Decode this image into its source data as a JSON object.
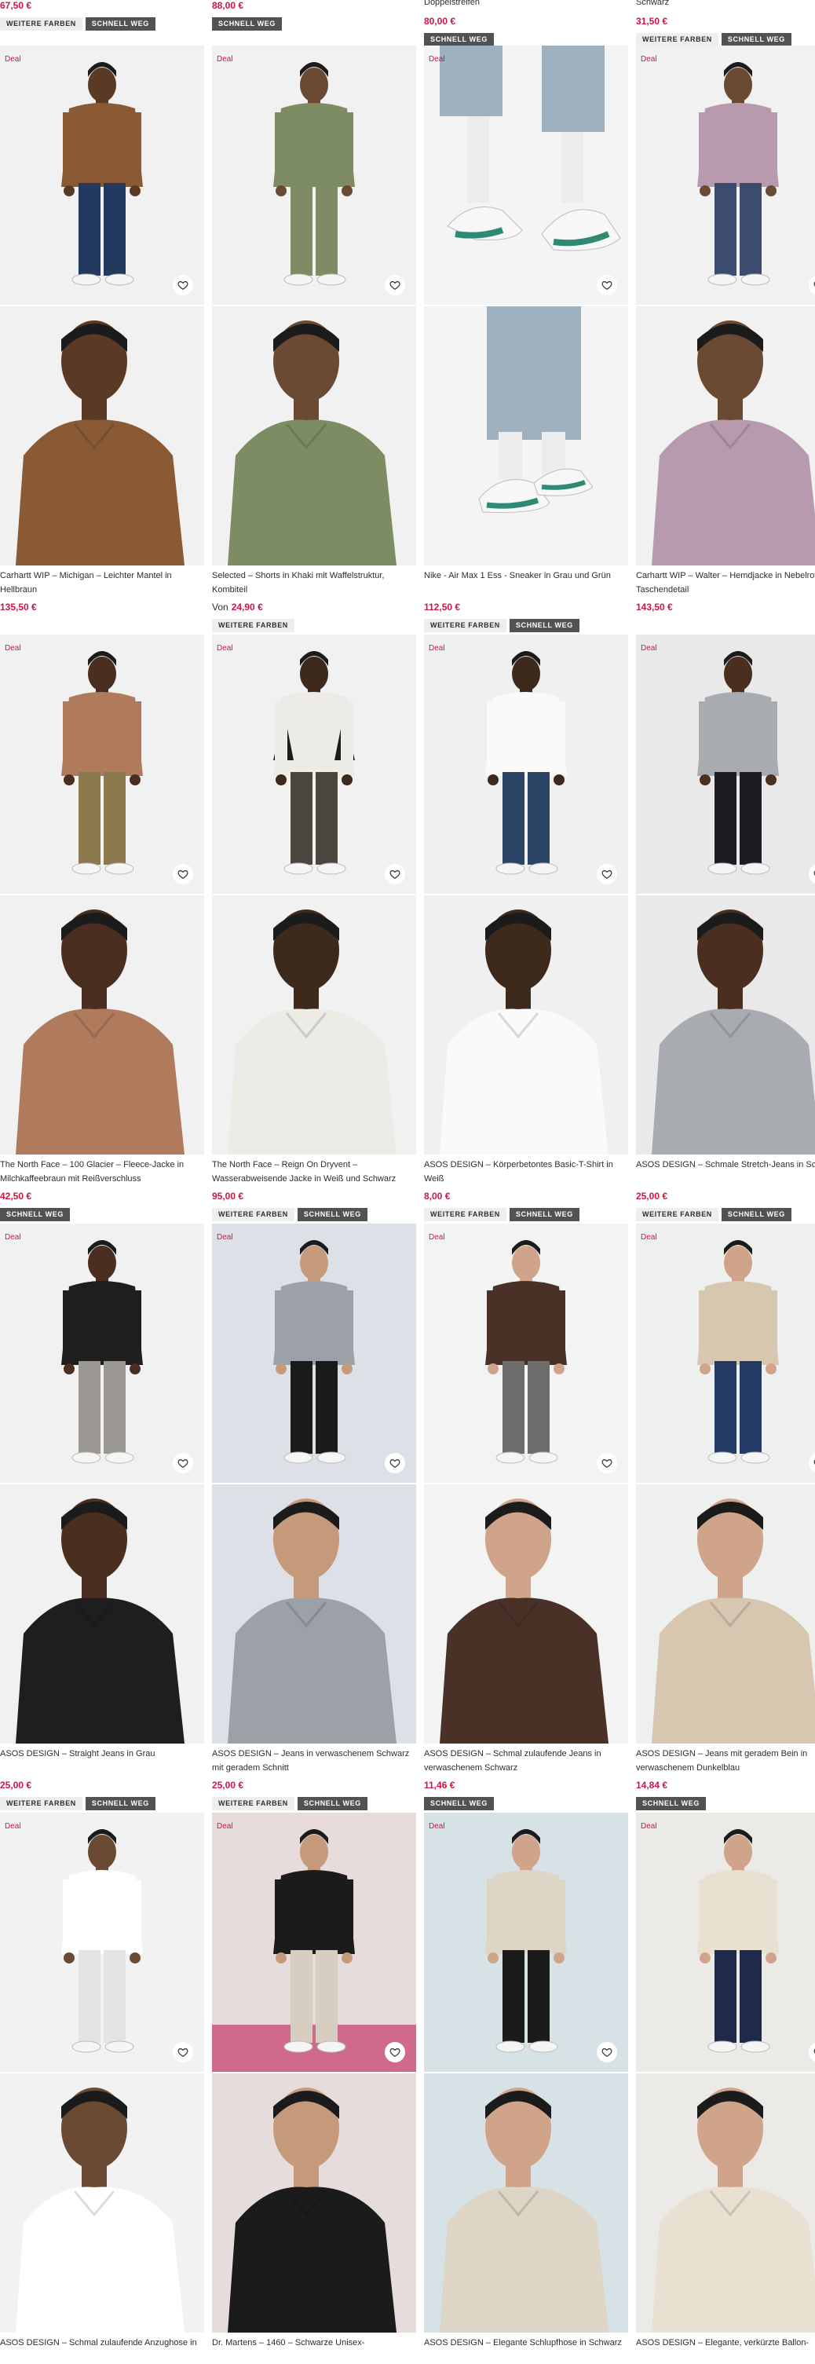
{
  "top": [
    {
      "price": "67,50 €",
      "badges": [
        "WEITERE FARBEN",
        "SCHNELL WEG"
      ]
    },
    {
      "price": "88,00 €",
      "badges": [
        "SCHNELL WEG"
      ]
    },
    {
      "title": "Doppelstreifen",
      "price": "80,00 €",
      "badges": [
        "SCHNELL WEG"
      ]
    },
    {
      "title": "Schwarz",
      "price": "31,50 €",
      "badges": [
        "WEITERE FARBEN",
        "SCHNELL WEG"
      ]
    }
  ],
  "products": [
    {
      "deal": "Deal",
      "title": "Carhartt WIP – Michigan – Leichter Mantel in Hellbraun",
      "from": "",
      "price": "135,50 €",
      "badges": []
    },
    {
      "deal": "Deal",
      "title": "Selected – Shorts in Khaki mit Waffelstruktur, Kombiteil",
      "from": "Von",
      "price": "24,90 €",
      "badges": [
        "WEITERE FARBEN"
      ]
    },
    {
      "deal": "Deal",
      "title": "Nike - Air Max 1 Ess - Sneaker in Grau und Grün",
      "from": "",
      "price": "112,50 €",
      "badges": [
        "WEITERE FARBEN",
        "SCHNELL WEG"
      ]
    },
    {
      "deal": "Deal",
      "title": "Carhartt WIP – Walter – Hemdjacke in Nebelrot mit Taschendetail",
      "from": "",
      "price": "143,50 €",
      "badges": []
    },
    {
      "deal": "Deal",
      "title": "The North Face – 100 Glacier – Fleece-Jacke in Milchkaffeebraun mit Reißverschluss",
      "from": "",
      "price": "42,50 €",
      "badges": [
        "SCHNELL WEG"
      ]
    },
    {
      "deal": "Deal",
      "title": "The North Face – Reign On Dryvent – Wasserabweisende Jacke in Weiß und Schwarz",
      "from": "",
      "price": "95,00 €",
      "badges": [
        "WEITERE FARBEN",
        "SCHNELL WEG"
      ]
    },
    {
      "deal": "Deal",
      "title": "ASOS DESIGN – Körperbetontes Basic-T-Shirt in Weiß",
      "from": "",
      "price": "8,00 €",
      "badges": [
        "WEITERE FARBEN",
        "SCHNELL WEG"
      ]
    },
    {
      "deal": "Deal",
      "title": "ASOS DESIGN – Schmale Stretch-Jeans in Schwarz",
      "from": "",
      "price": "25,00 €",
      "badges": [
        "WEITERE FARBEN",
        "SCHNELL WEG"
      ]
    },
    {
      "deal": "Deal",
      "title": "ASOS DESIGN – Straight Jeans in Grau",
      "from": "",
      "price": "25,00 €",
      "badges": [
        "WEITERE FARBEN",
        "SCHNELL WEG"
      ]
    },
    {
      "deal": "Deal",
      "title": "ASOS DESIGN – Jeans in verwaschenem Schwarz mit geradem Schnitt",
      "from": "",
      "price": "25,00 €",
      "badges": [
        "WEITERE FARBEN",
        "SCHNELL WEG"
      ]
    },
    {
      "deal": "Deal",
      "title": "ASOS DESIGN – Schmal zulaufende Jeans in verwaschenem Schwarz",
      "from": "",
      "price": "11,46 €",
      "badges": [
        "SCHNELL WEG"
      ]
    },
    {
      "deal": "Deal",
      "title": "ASOS DESIGN – Jeans mit geradem Bein in verwaschenem Dunkelblau",
      "from": "",
      "price": "14,84 €",
      "badges": [
        "SCHNELL WEG"
      ]
    },
    {
      "deal": "Deal",
      "title": "ASOS DESIGN – Schmal zulaufende Anzughose in",
      "from": "",
      "price": "",
      "badges": []
    },
    {
      "deal": "Deal",
      "title": "Dr. Martens – 1460 – Schwarze Unisex-",
      "from": "",
      "price": "",
      "badges": []
    },
    {
      "deal": "Deal",
      "title": "ASOS DESIGN – Elegante Schlupfhose in Schwarz",
      "from": "",
      "price": "",
      "badges": []
    },
    {
      "deal": "Deal",
      "title": "ASOS DESIGN – Elegante, verkürzte Ballon-",
      "from": "",
      "price": "",
      "badges": []
    }
  ],
  "colors": {
    "accent": "#d01345",
    "badge_dark": "#525252",
    "badge_light": "#eeeeee",
    "text": "#2d2d2d"
  },
  "icons": {
    "wishlist": "heart-icon"
  }
}
